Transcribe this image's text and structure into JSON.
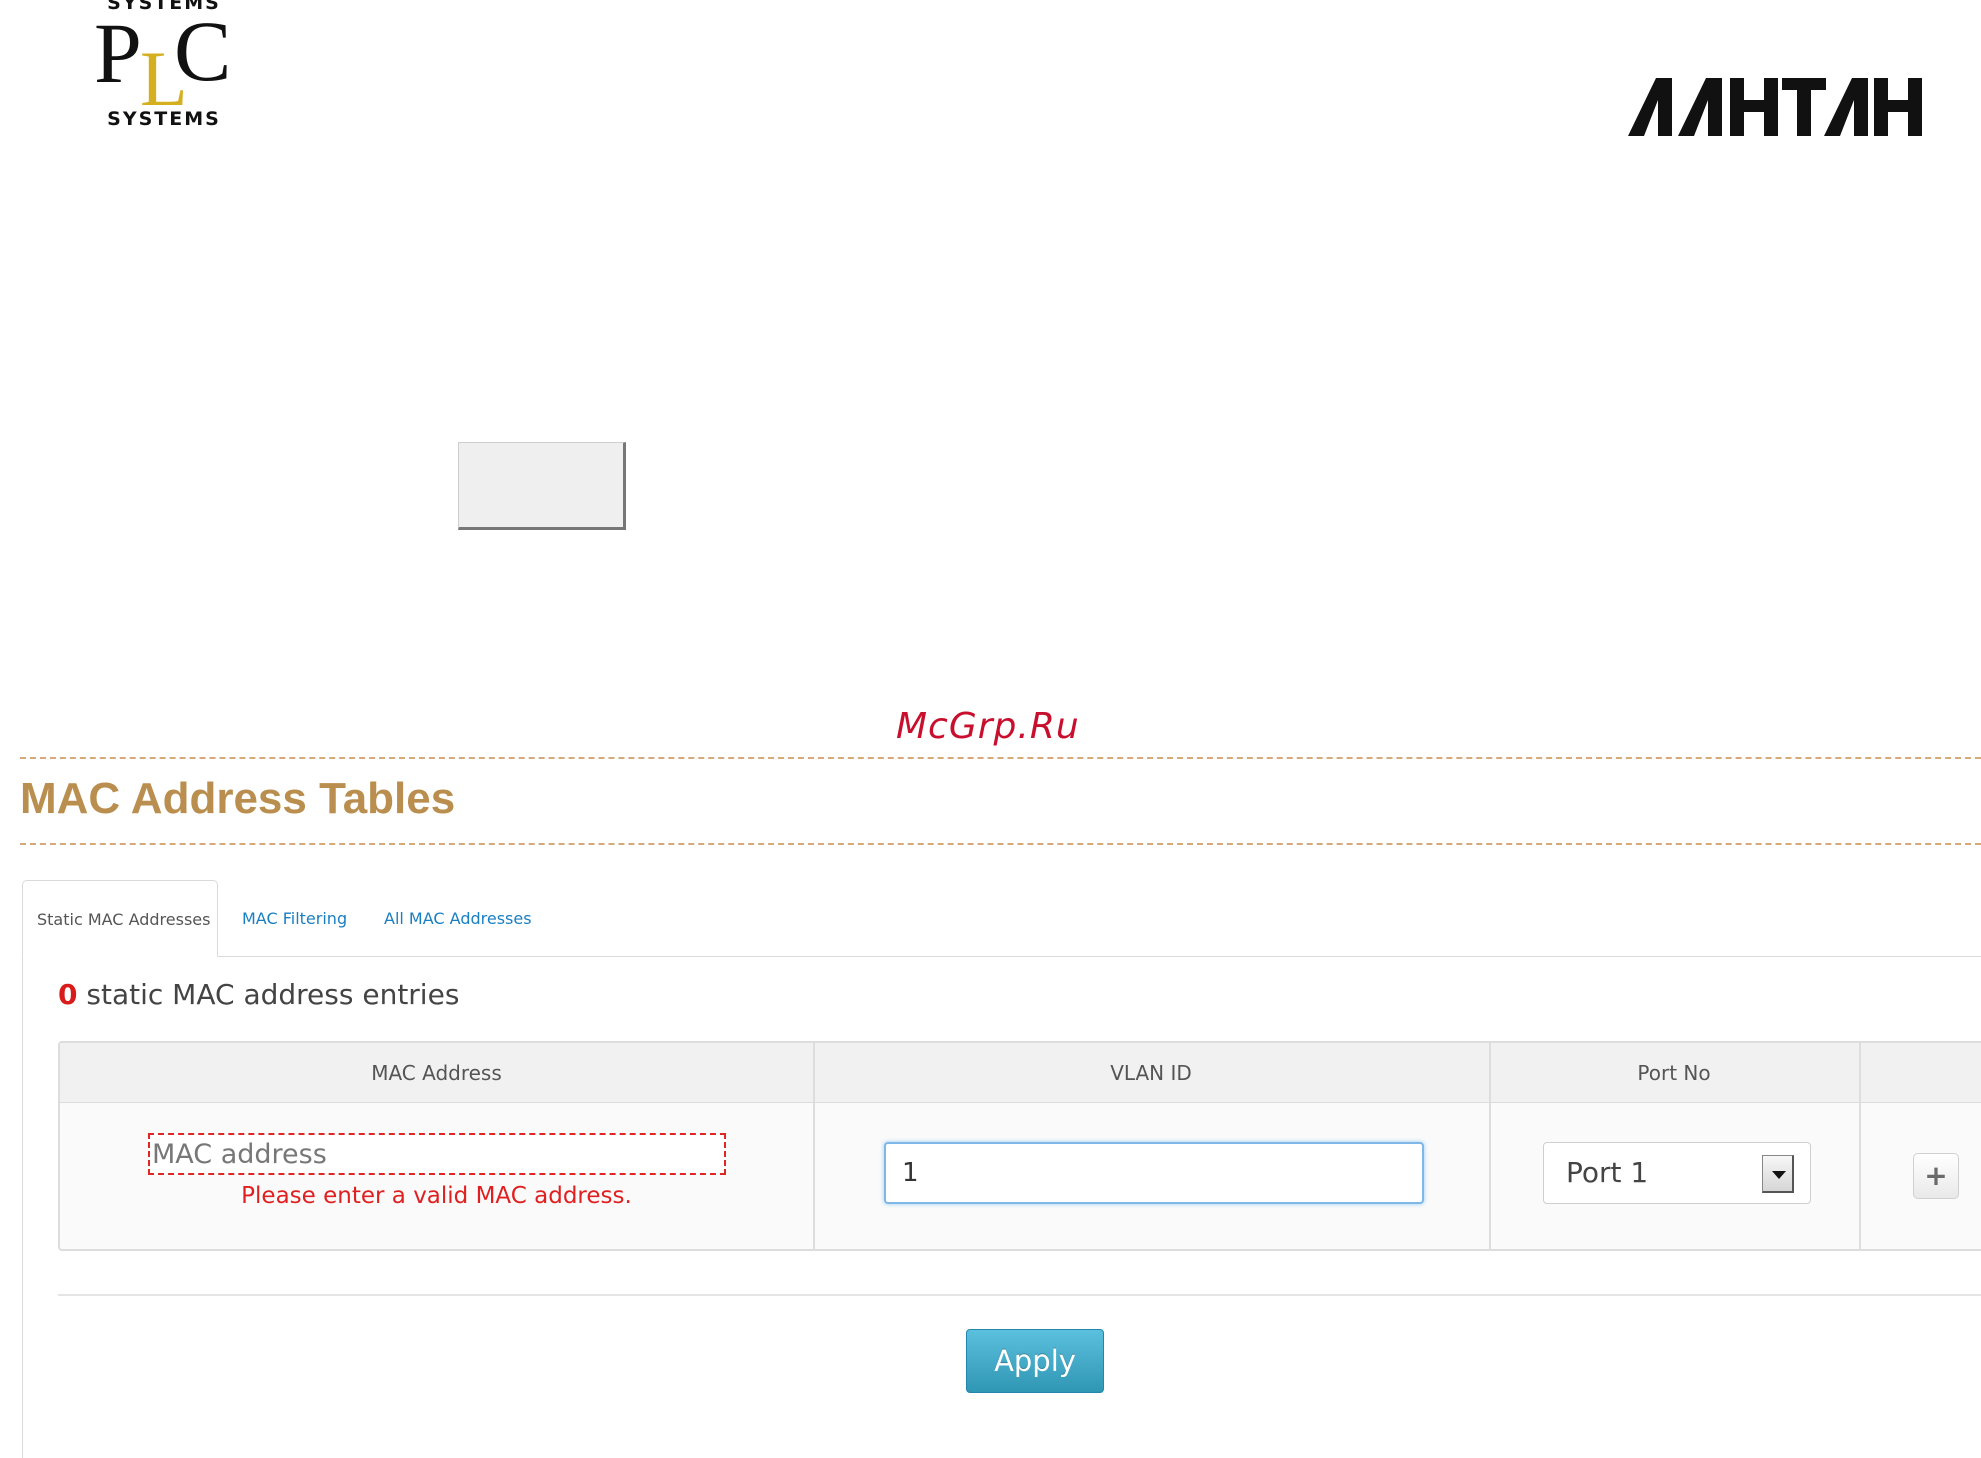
{
  "logos": {
    "plc": {
      "top_text": "SYSTEMS",
      "letters": [
        "P",
        "L",
        "C"
      ],
      "bottom_text": "SYSTEMS"
    },
    "lantan": {
      "text": "ΛΑΗΤΑΗ"
    }
  },
  "watermark": "McGrp.Ru",
  "page": {
    "title": "MAC Address Tables"
  },
  "tabs": [
    {
      "label": "Static MAC Addresses",
      "active": true
    },
    {
      "label": "MAC Filtering",
      "active": false
    },
    {
      "label": "All MAC Addresses",
      "active": false
    }
  ],
  "summary": {
    "count": "0",
    "text": "static MAC address entries"
  },
  "table": {
    "headers": {
      "mac": "MAC Address",
      "vlan": "VLAN ID",
      "port": "Port No"
    },
    "new_row": {
      "mac_placeholder": "MAC address",
      "mac_value": "",
      "mac_error": "Please enter a valid MAC address.",
      "vlan_value": "1",
      "port_selected": "Port 1",
      "add_symbol": "+"
    }
  },
  "actions": {
    "apply_label": "Apply"
  },
  "colors": {
    "title": "#b98e4e",
    "link": "#1a7fc1",
    "error": "#e02020",
    "apply_bg": "#5bc0de",
    "plc_l": "#d4af1f"
  }
}
